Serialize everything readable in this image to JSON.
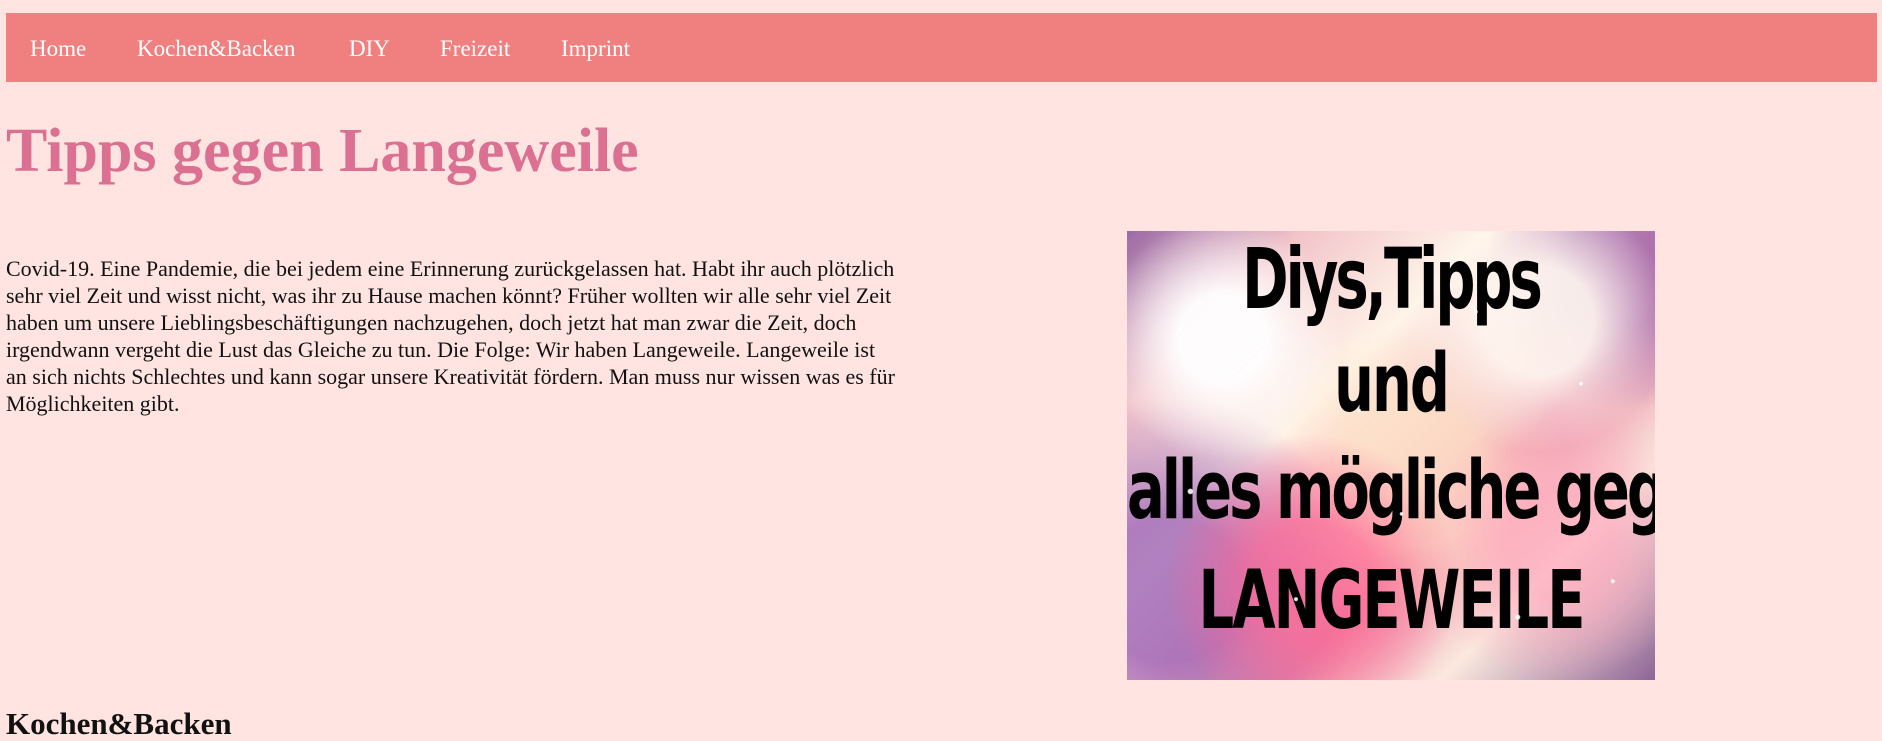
{
  "nav": {
    "items": [
      {
        "label": "Home"
      },
      {
        "label": "Kochen&Backen"
      },
      {
        "label": "DIY"
      },
      {
        "label": "Freizeit"
      },
      {
        "label": "Imprint"
      }
    ]
  },
  "main": {
    "title": "Tipps gegen Langeweile",
    "intro": "Covid-19. Eine Pandemie, die bei jedem eine Erinnerung zurückgelassen hat. Habt ihr auch plötzlich sehr viel Zeit und wisst nicht, was ihr zu Hause machen könnt? Früher wollten wir alle sehr viel Zeit haben um unsere Lieblingsbeschäftigungen nachzugehen, doch jetzt hat man zwar die Zeit, doch irgendwann vergeht die Lust das Gleiche zu tun. Die Folge: Wir haben Langeweile. Langeweile ist an sich nichts Schlechtes und kann sogar unsere Kreativität fördern. Man muss nur wissen was es für Möglichkeiten gibt.",
    "hero_image": {
      "lines": [
        "Diys,Tipps",
        "und",
        "alles mögliche gegen",
        "LANGEWEILE"
      ]
    },
    "next_section_heading": "Kochen&Backen"
  },
  "colors": {
    "page_background": "#ffe4e1",
    "nav_background": "#f08080",
    "nav_text": "#ffffff",
    "title": "#db7093",
    "body_text": "#111111"
  }
}
